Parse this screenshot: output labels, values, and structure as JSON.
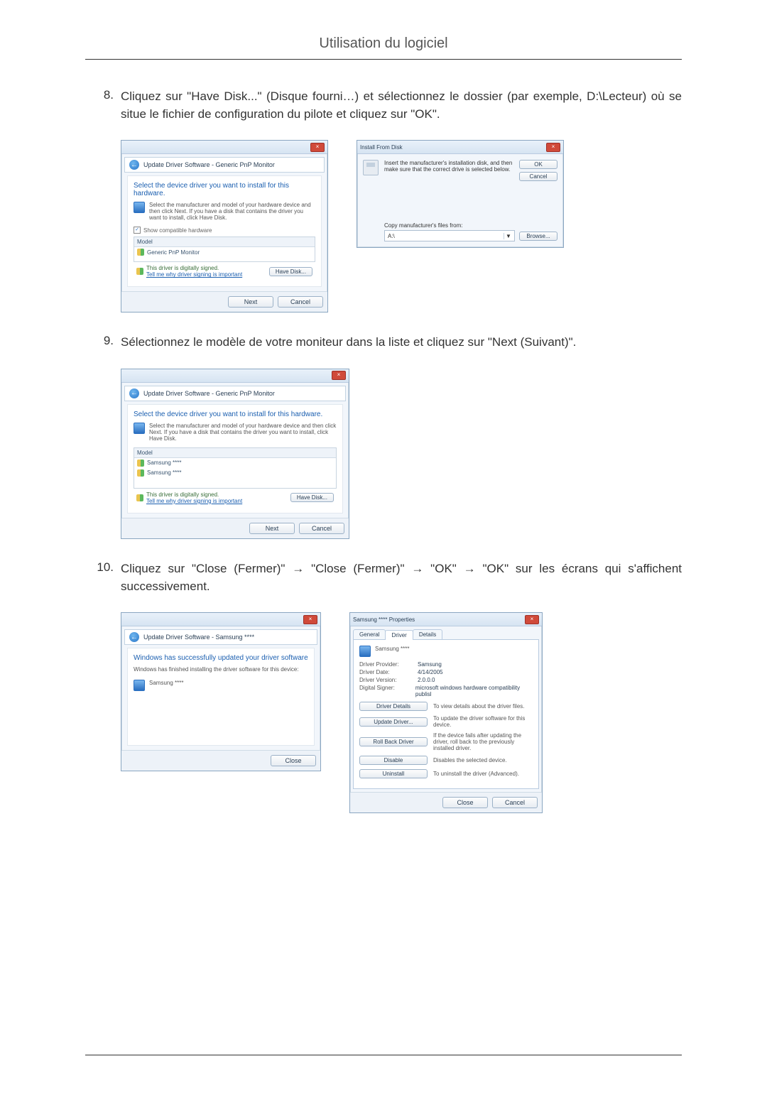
{
  "header": {
    "title": "Utilisation du logiciel"
  },
  "steps": {
    "s8": {
      "num": "8.",
      "text": "Cliquez sur \"Have Disk...\" (Disque fourni…) et sélectionnez le dossier (par exemple, D:\\Lecteur) où se situe le fichier de configuration du pilote et cliquez sur \"OK\"."
    },
    "s9": {
      "num": "9.",
      "text": "Sélectionnez le modèle de votre moniteur dans la liste et cliquez sur \"Next (Suivant)\"."
    },
    "s10": {
      "num": "10.",
      "text": "Cliquez sur \"Close (Fermer)\" → \"Close (Fermer)\" → \"OK\" → \"OK\" sur les écrans qui s'affichent successivement."
    }
  },
  "winA": {
    "crumb": "Update Driver Software - Generic PnP Monitor",
    "heading": "Select the device driver you want to install for this hardware.",
    "hint": "Select the manufacturer and model of your hardware device and then click Next. If you have a disk that contains the driver you want to install, click Have Disk.",
    "showCompat": "Show compatible hardware",
    "listHeader": "Model",
    "item1": "Generic PnP Monitor",
    "signed": "This driver is digitally signed.",
    "tell": "Tell me why driver signing is important",
    "haveDisk": "Have Disk...",
    "next": "Next",
    "cancel": "Cancel"
  },
  "winB": {
    "title": "Install From Disk",
    "msg": "Insert the manufacturer's installation disk, and then make sure that the correct drive is selected below.",
    "copy": "Copy manufacturer's files from:",
    "drive": "A:\\",
    "ok": "OK",
    "cancel": "Cancel",
    "browse": "Browse..."
  },
  "winC": {
    "crumb": "Update Driver Software - Generic PnP Monitor",
    "heading": "Select the device driver you want to install for this hardware.",
    "hint": "Select the manufacturer and model of your hardware device and then click Next. If you have a disk that contains the driver you want to install, click Have Disk.",
    "listHeader": "Model",
    "item1": "Samsung ****",
    "item2": "Samsung ****",
    "signed": "This driver is digitally signed.",
    "tell": "Tell me why driver signing is important",
    "haveDisk": "Have Disk...",
    "next": "Next",
    "cancel": "Cancel"
  },
  "winD": {
    "crumb": "Update Driver Software - Samsung ****",
    "heading": "Windows has successfully updated your driver software",
    "sub": "Windows has finished installing the driver software for this device:",
    "device": "Samsung ****",
    "close": "Close"
  },
  "winE": {
    "title": "Samsung **** Properties",
    "tab1": "General",
    "tab2": "Driver",
    "tab3": "Details",
    "device": "Samsung ****",
    "prov_k": "Driver Provider:",
    "prov_v": "Samsung",
    "date_k": "Driver Date:",
    "date_v": "4/14/2005",
    "ver_k": "Driver Version:",
    "ver_v": "2.0.0.0",
    "sign_k": "Digital Signer:",
    "sign_v": "microsoft windows hardware compatibility publisl",
    "b_details": "Driver Details",
    "d_details": "To view details about the driver files.",
    "b_update": "Update Driver...",
    "d_update": "To update the driver software for this device.",
    "b_roll": "Roll Back Driver",
    "d_roll": "If the device fails after updating the driver, roll back to the previously installed driver.",
    "b_disable": "Disable",
    "d_disable": "Disables the selected device.",
    "b_uninstall": "Uninstall",
    "d_uninstall": "To uninstall the driver (Advanced).",
    "close": "Close",
    "cancel": "Cancel"
  }
}
